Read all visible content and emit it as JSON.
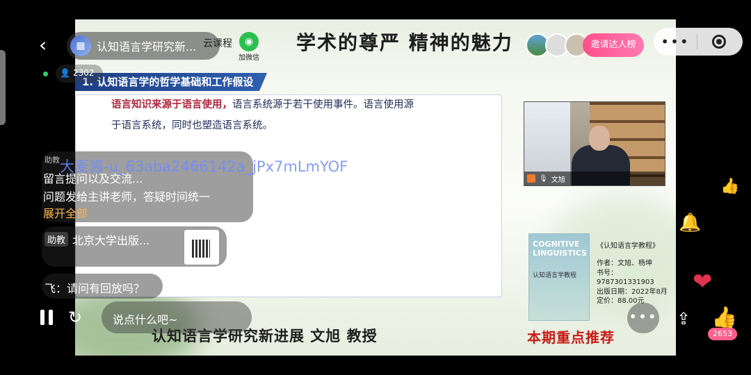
{
  "header": {
    "channel_title": "认知语言学研究新...",
    "channel_suffix": "云课程",
    "wechat_label": "加微信",
    "viewer_count": "2302",
    "invite_label": "邀请达人榜",
    "more_icon": "more-dots-icon",
    "close_icon": "target-icon"
  },
  "slide": {
    "banner_top": "学术的尊严  精神的魅力",
    "section_header": "1. 认知语言学的哲学基础和工作假设",
    "text_line1_highlight": "语言知识来源于语言使用，",
    "text_line1_rest": "语言系统源于若干使用事件。语言使用源",
    "text_line2": "于语言系统，同时也塑造语言系统。",
    "book_cover_title": "COGNITIVE LINGUISTICS",
    "book_cover_sub": "认知语言学教程",
    "book_title": "《认知语言学教程》",
    "book_author": "作者：文旭、杨坤",
    "book_isbn": "书号：9787301331903",
    "book_date": "出版日期：2022年8月",
    "book_price": "定价：88.00元",
    "banner_bottom": "认知语言学研究新进展   文旭  教授",
    "banner_bottom_right": "本期重点推荐",
    "cam_name": "文旭"
  },
  "chat": {
    "notice_tag": "助教",
    "notice_user": "大麦酱-u_63aba2466142a_jPx7mLmYOF",
    "notice_line1": "留言提问以及交流...",
    "notice_line2": "问题发给主讲老师，答疑时间统一",
    "expand_label": "展开全部",
    "msg2_tag": "助教",
    "msg2_text": "北京大学出版...",
    "msg3_text": "飞：请问有回放吗？"
  },
  "bottom": {
    "comment_placeholder": "说点什么吧~",
    "like_count": "2653"
  },
  "colors": {
    "accent_pink": "#ff5f8d",
    "header_blue": "#1d3f86",
    "highlight_red": "#b0263a",
    "online_green": "#2fd36a"
  }
}
